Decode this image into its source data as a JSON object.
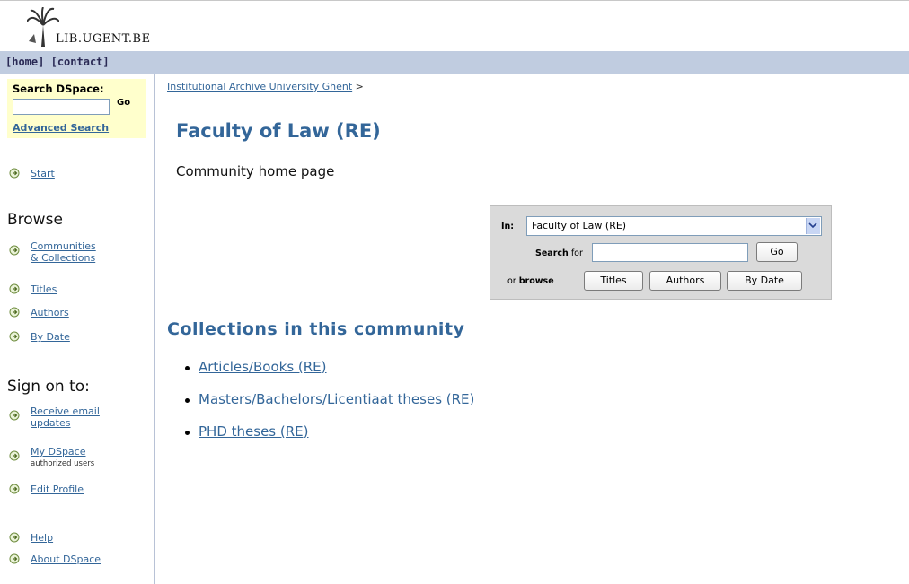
{
  "header": {
    "logo_text": "LIB.UGENT.BE",
    "nav_home": "[home]",
    "nav_contact": "[contact]"
  },
  "sidebar": {
    "search_title": "Search DSpace:",
    "search_go": "Go",
    "advanced_search": "Advanced Search",
    "start": "Start",
    "browse_heading": "Browse",
    "browse_items": [
      "Communities",
      "& Collections",
      "Titles",
      "Authors",
      "By Date"
    ],
    "sign_heading": "Sign on to:",
    "receive_email": [
      "Receive email",
      "updates"
    ],
    "my_dspace": "My DSpace",
    "my_dspace_sub": "authorized users",
    "edit_profile": "Edit Profile",
    "help": "Help",
    "about": "About DSpace"
  },
  "main": {
    "breadcrumb_link": "Institutional Archive University Ghent",
    "breadcrumb_sep": ">",
    "title": "Faculty of Law (RE)",
    "subtitle": "Community home page",
    "search_panel": {
      "in_label": "In:",
      "scope_value": "Faculty of Law (RE)",
      "search_for_bold": "Search",
      "search_for_rest": "for",
      "go_label": "Go",
      "or_label": "or",
      "browse_label": "browse",
      "titles_btn": "Titles",
      "authors_btn": "Authors",
      "bydate_btn": "By Date"
    },
    "collections_heading": "Collections in this community",
    "collections": [
      "Articles/Books (RE)",
      "Masters/Bachelors/Licentiaat theses (RE)",
      "PHD theses (RE)"
    ]
  },
  "colors": {
    "link": "#336699",
    "navbar": "#c0cce0",
    "search_bg": "#ffffcc",
    "panel_bg": "#dadada"
  }
}
